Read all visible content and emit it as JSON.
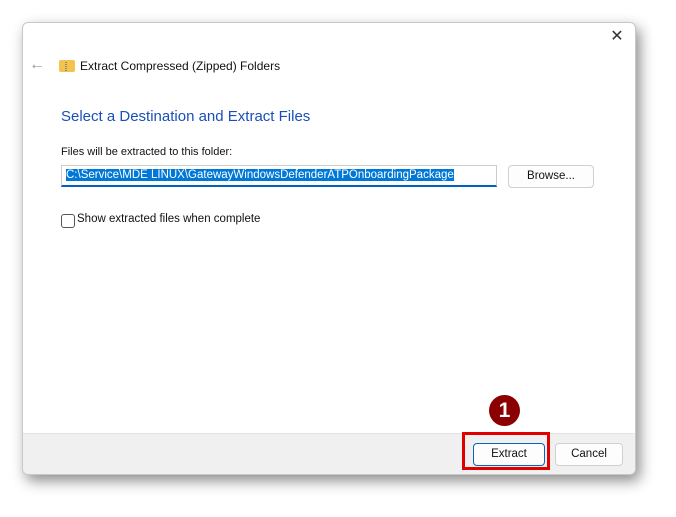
{
  "window": {
    "title": "Extract Compressed (Zipped) Folders",
    "close_icon": "close-icon",
    "back_icon": "back-arrow-icon"
  },
  "main": {
    "heading": "Select a Destination and Extract Files",
    "folder_label": "Files will be extracted to this folder:",
    "path_value": "C:\\Service\\MDE LINUX\\GatewayWindowsDefenderATPOnboardingPackage",
    "browse_label": "Browse...",
    "show_files_label": "Show extracted files when complete",
    "show_files_checked": false
  },
  "footer": {
    "extract_label": "Extract",
    "cancel_label": "Cancel"
  },
  "annotation": {
    "step": "1",
    "color": "#8b0000",
    "highlight_color": "#e00000"
  }
}
